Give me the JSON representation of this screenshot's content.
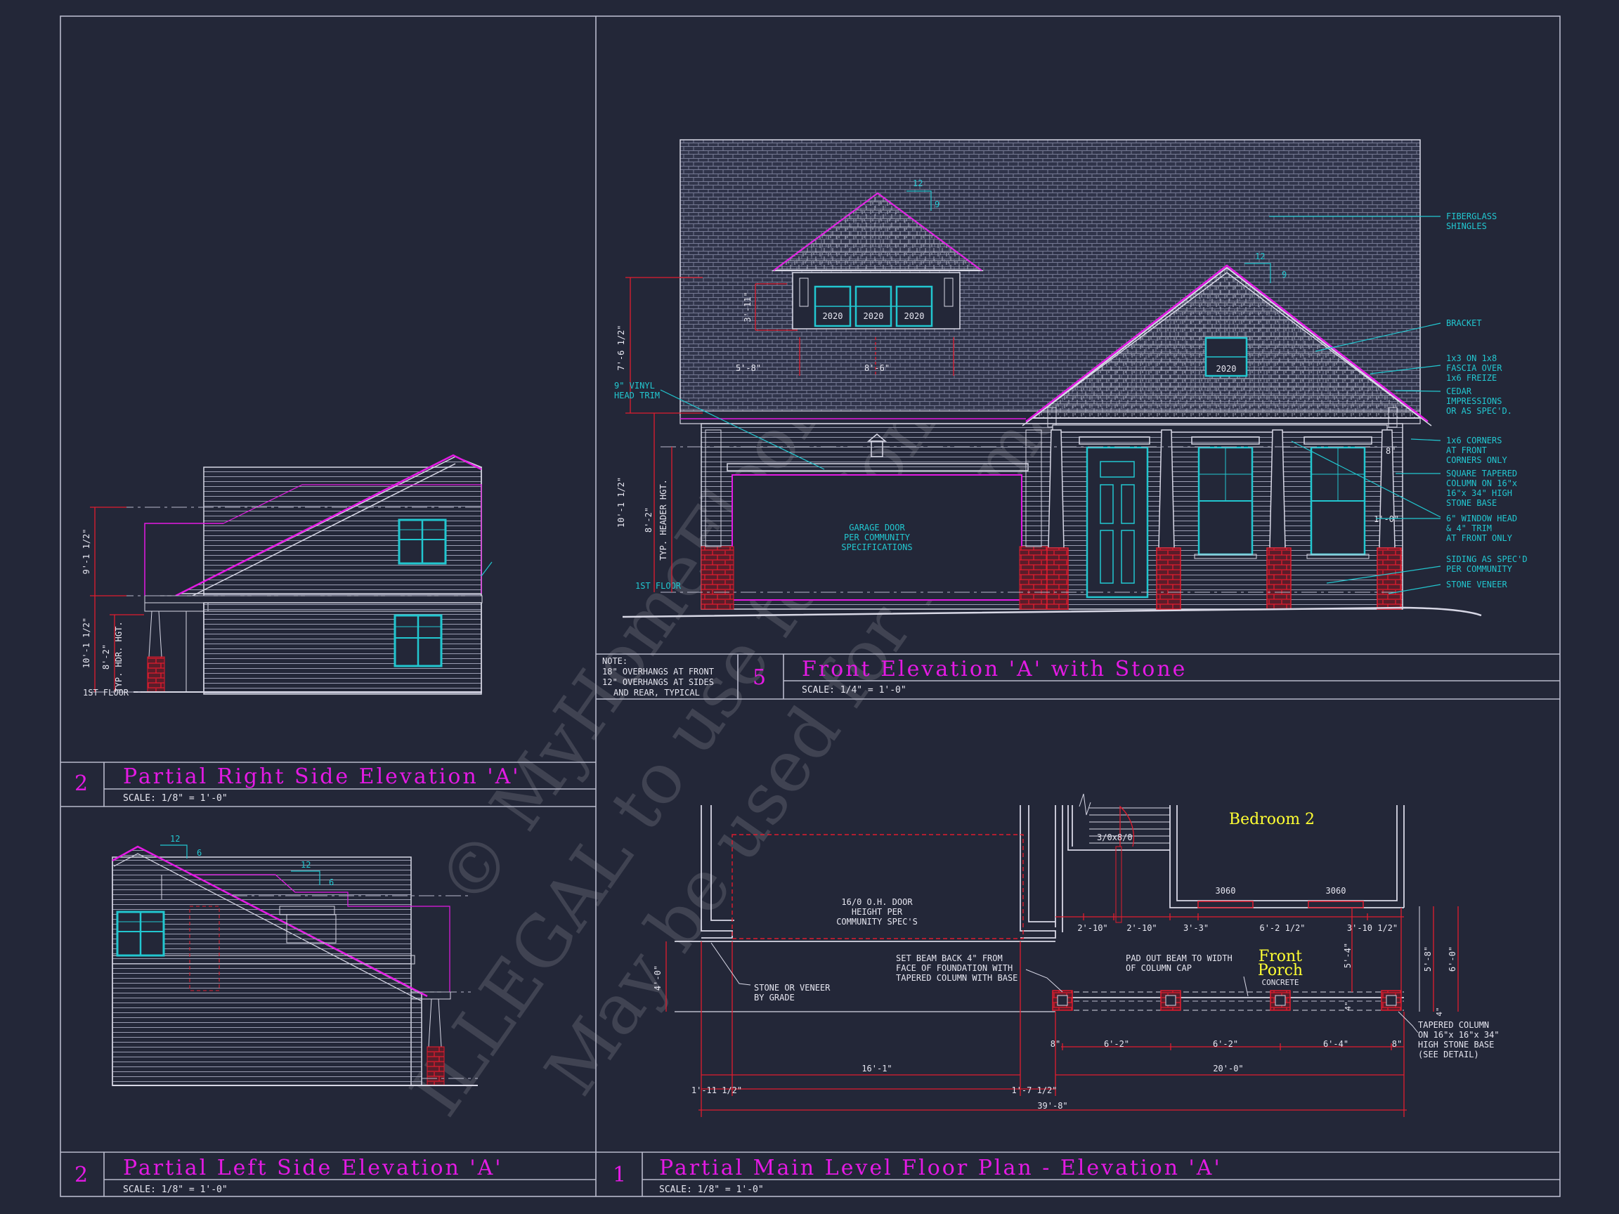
{
  "watermark": {
    "line1": "© MyHomeFloorPlans",
    "line2": "ILLEGAL to use for Construction",
    "line3": "May be used for Estimation"
  },
  "colors": {
    "background": "#232738",
    "line": "#d8d8e6",
    "title": "#e41ae4",
    "dim": "#e01c2e",
    "accent": "#22c7d0",
    "label": "#ffff33"
  },
  "panels": {
    "right_side": {
      "number": "2",
      "title": "Partial Right Side Elevation 'A'",
      "scale": "SCALE: 1/8\" = 1'-0\""
    },
    "left_side": {
      "number": "2",
      "title": "Partial Left Side Elevation 'A'",
      "scale": "SCALE: 1/8\" = 1'-0\""
    },
    "front": {
      "number": "5",
      "title": "Front Elevation 'A' with Stone",
      "scale": "SCALE: 1/4\" = 1'-0\""
    },
    "floor_plan": {
      "number": "1",
      "title": "Partial Main Level Floor Plan - Elevation 'A'",
      "scale": "SCALE: 1/8\" = 1'-0\""
    }
  },
  "note": {
    "heading": "NOTE:",
    "lines": [
      "18\" OVERHANGS AT FRONT",
      "12\" OVERHANGS AT SIDES",
      "AND REAR, TYPICAL"
    ]
  },
  "front_elevation": {
    "callouts": [
      [
        "FIBERGLASS",
        "SHINGLES"
      ],
      [
        "BRACKET"
      ],
      [
        "1x3 ON 1x8",
        "FASCIA OVER",
        "1x6 FREIZE"
      ],
      [
        "CEDAR",
        "IMPRESSIONS",
        "OR AS SPEC'D."
      ],
      [
        "1x6 CORNERS",
        "AT FRONT",
        "CORNERS ONLY"
      ],
      [
        "SQUARE TAPERED",
        "COLUMN ON 16\"x",
        "16\"x 34\" HIGH",
        "STONE BASE"
      ],
      [
        "6\" WINDOW HEAD",
        "& 4\" TRIM",
        "AT FRONT ONLY"
      ],
      [
        "SIDING AS SPEC'D",
        "PER COMMUNITY"
      ],
      [
        "STONE VENEER"
      ]
    ],
    "vinyl_trim": [
      "9\" VINYL",
      "HEAD TRIM"
    ],
    "garage_door": [
      "GARAGE DOOR",
      "PER COMMUNITY",
      "SPECIFICATIONS"
    ],
    "window_tags": [
      "2020",
      "2020",
      "2020",
      "2020"
    ],
    "pitch_rise": "9",
    "pitch_run": "12",
    "floor_label": "1ST FLOOR",
    "dims": {
      "upper_height": "7'-6 1/2\"",
      "lower_height": "10'-1 1/2\"",
      "hdr_height": "8'-2\"",
      "hdr_label": "TYP. HEADER HGT.",
      "dormer_height": "3'-11\"",
      "dormer_left": "5'-8\"",
      "dormer_width": "8'-6\"",
      "side_small": "8\"",
      "side_small2": "1'-0\""
    }
  },
  "right_side_elevation": {
    "height_upper": "9'-1 1/2\"",
    "height_lower": "10'-1 1/2\"",
    "hdr": "8'-2\"",
    "hdr_label": "TYP. HDR. HGT.",
    "floor_label": "1ST FLOOR"
  },
  "left_side_elevation": {
    "pitch_run": "12",
    "pitch_rise": "6"
  },
  "floor_plan": {
    "room": "Bedroom 2",
    "porch": [
      "Front",
      "Porch"
    ],
    "porch_sub": "CONCRETE",
    "door_tag": "3/0x8/0",
    "window_tags": [
      "3060",
      "3060"
    ],
    "garage_door": [
      "16/0 O.H. DOOR",
      "HEIGHT PER",
      "COMMUNITY SPEC'S"
    ],
    "notes": {
      "stone": [
        "STONE OR VENEER",
        "BY GRADE"
      ],
      "beam": [
        "SET BEAM BACK 4\" FROM",
        "FACE OF FOUNDATION WITH",
        "TAPERED COLUMN WITH BASE"
      ],
      "pad": [
        "PAD OUT BEAM TO WIDTH",
        "OF COLUMN CAP"
      ],
      "column": [
        "TAPERED COLUMN",
        "ON 16\"x 16\"x 34\"",
        "HIGH STONE BASE",
        "(SEE DETAIL)"
      ]
    },
    "dims_top": [
      "2'-10\"",
      "2'-10\"",
      "3'-3\"",
      "6'-2 1/2\"",
      "3'-10 1/2\""
    ],
    "dims_cols": [
      "8\"",
      "6'-2\"",
      "6'-2\"",
      "6'-4\"",
      "8\""
    ],
    "dim_garage": "16'-1\"",
    "dim_porch": "20'-0\"",
    "dim_left": "1'-11 1/2\"",
    "dim_mid": "1'-7 1/2\"",
    "dim_total": "39'-8\"",
    "dim_depth": "4'-0\"",
    "dim_porch_depth": "5'-4\"",
    "dim_right1": "5'-8\"",
    "dim_right2": "6'-0\"",
    "dim_small": "4\""
  }
}
